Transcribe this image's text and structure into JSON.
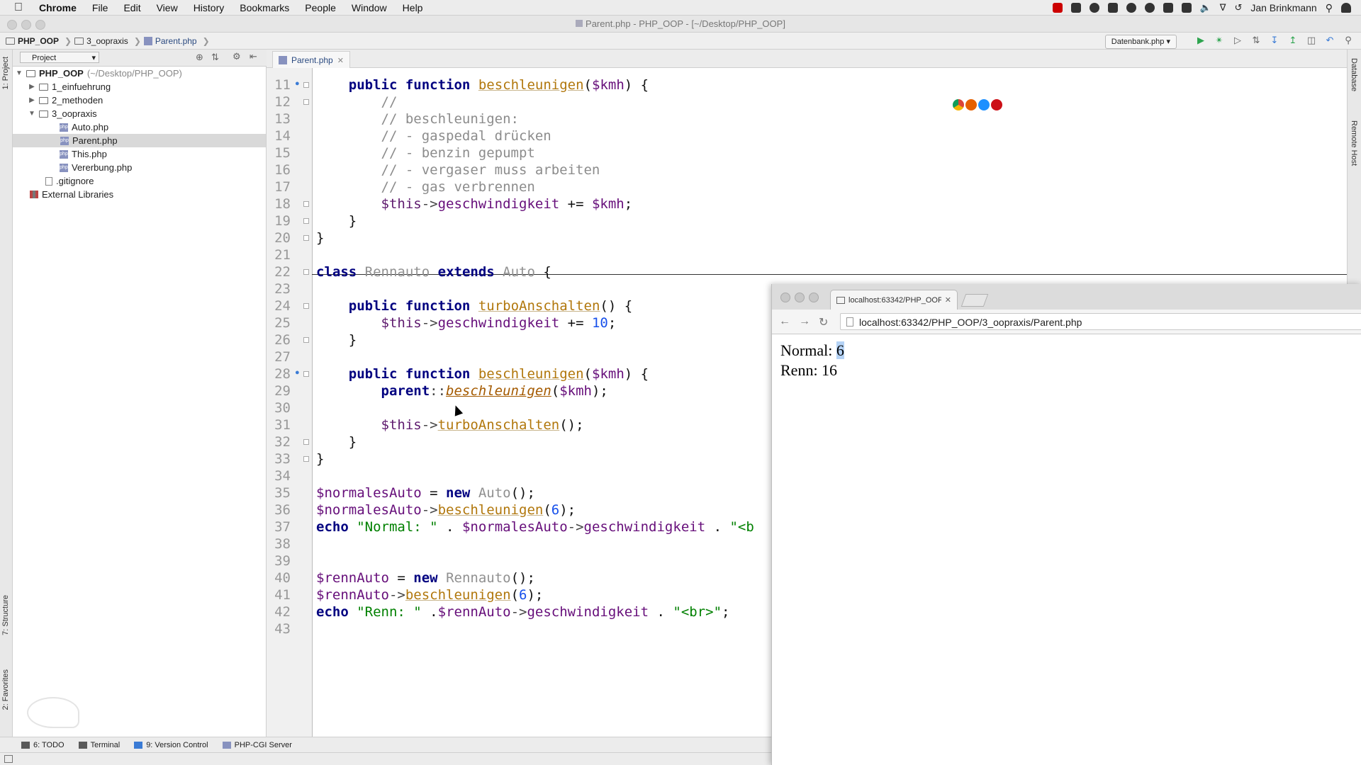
{
  "menubar": {
    "app": "Chrome",
    "items": [
      "File",
      "Edit",
      "View",
      "History",
      "Bookmarks",
      "People",
      "Window",
      "Help"
    ],
    "user": "Jan Brinkmann"
  },
  "ide": {
    "title": "Parent.php - PHP_OOP - [~/Desktop/PHP_OOP]",
    "breadcrumbs": [
      "PHP_OOP",
      "3_oopraxis",
      "Parent.php"
    ],
    "run_config": "Datenbank.php",
    "project_label": "Project",
    "left_tabs": [
      "1: Project",
      "7: Structure",
      "2: Favorites"
    ],
    "right_tabs": [
      "Database",
      "Remote Host"
    ],
    "editor_tab": "Parent.php",
    "bottom_tabs": [
      "6: TODO",
      "Terminal",
      "9: Version Control",
      "PHP-CGI Server"
    ]
  },
  "tree": [
    {
      "label": "PHP_OOP",
      "hint": " (~/Desktop/PHP_OOP)",
      "depth": 0,
      "type": "folder",
      "open": true
    },
    {
      "label": "1_einfuehrung",
      "depth": 1,
      "type": "folder",
      "open": false
    },
    {
      "label": "2_methoden",
      "depth": 1,
      "type": "folder",
      "open": false
    },
    {
      "label": "3_oopraxis",
      "depth": 1,
      "type": "folder",
      "open": true
    },
    {
      "label": "Auto.php",
      "depth": 2,
      "type": "php"
    },
    {
      "label": "Parent.php",
      "depth": 2,
      "type": "php",
      "selected": true
    },
    {
      "label": "This.php",
      "depth": 2,
      "type": "php"
    },
    {
      "label": "Vererbung.php",
      "depth": 2,
      "type": "php"
    },
    {
      "label": ".gitignore",
      "depth": 1,
      "type": "file"
    },
    {
      "label": "External Libraries",
      "depth": 0,
      "type": "lib"
    }
  ],
  "code_lines": [
    {
      "n": "11",
      "t": "    public function beschleunigen($kmh) {"
    },
    {
      "n": "12",
      "t": "        //"
    },
    {
      "n": "13",
      "t": "        // beschleunigen:"
    },
    {
      "n": "14",
      "t": "        // - gaspedal drücken"
    },
    {
      "n": "15",
      "t": "        // - benzin gepumpt"
    },
    {
      "n": "16",
      "t": "        // - vergaser muss arbeiten"
    },
    {
      "n": "17",
      "t": "        // - gas verbrennen"
    },
    {
      "n": "18",
      "t": "        $this->geschwindigkeit += $kmh;"
    },
    {
      "n": "19",
      "t": "    }"
    },
    {
      "n": "20",
      "t": "}"
    },
    {
      "n": "21",
      "t": ""
    },
    {
      "n": "22",
      "t": "class Rennauto extends Auto {"
    },
    {
      "n": "23",
      "t": ""
    },
    {
      "n": "24",
      "t": "    public function turboAnschalten() {"
    },
    {
      "n": "25",
      "t": "        $this->geschwindigkeit += 10;"
    },
    {
      "n": "26",
      "t": "    }"
    },
    {
      "n": "27",
      "t": ""
    },
    {
      "n": "28",
      "t": "    public function beschleunigen($kmh) {"
    },
    {
      "n": "29",
      "t": "        parent::beschleunigen($kmh);"
    },
    {
      "n": "30",
      "t": ""
    },
    {
      "n": "31",
      "t": "        $this->turboAnschalten();"
    },
    {
      "n": "32",
      "t": "    }"
    },
    {
      "n": "33",
      "t": "}"
    },
    {
      "n": "34",
      "t": ""
    },
    {
      "n": "35",
      "t": "$normalesAuto = new Auto();"
    },
    {
      "n": "36",
      "t": "$normalesAuto->beschleunigen(6);"
    },
    {
      "n": "37",
      "t": "echo \"Normal: \" . $normalesAuto->geschwindigkeit . \"<b"
    },
    {
      "n": "38",
      "t": ""
    },
    {
      "n": "39",
      "t": ""
    },
    {
      "n": "40",
      "t": "$rennAuto = new Rennauto();"
    },
    {
      "n": "41",
      "t": "$rennAuto->beschleunigen(6);"
    },
    {
      "n": "42",
      "t": "echo \"Renn: \" .$rennAuto->geschwindigkeit . \"<br>\";"
    },
    {
      "n": "43",
      "t": ""
    }
  ],
  "browser": {
    "tab_title": "localhost:63342/PHP_OOP",
    "url": "localhost:63342/PHP_OOP/3_oopraxis/Parent.php",
    "output": {
      "normal_label": "Normal: ",
      "normal_value": "6",
      "renn_line": "Renn: 16"
    }
  }
}
